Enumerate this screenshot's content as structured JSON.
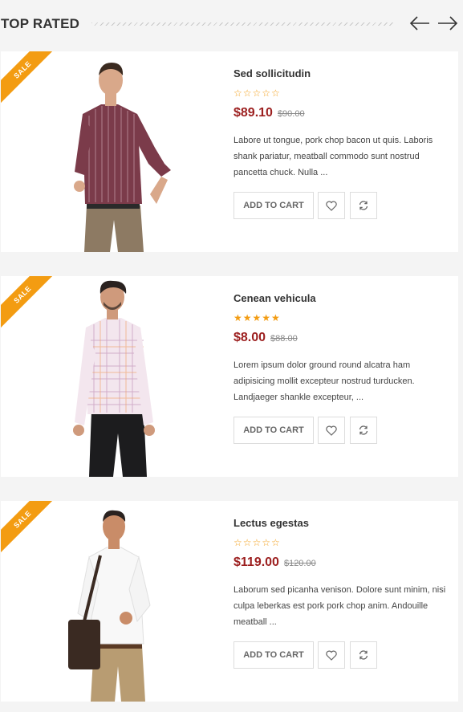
{
  "section": {
    "title": "TOP RATED"
  },
  "nav": {
    "prev_icon": "arrow-left-icon",
    "next_icon": "arrow-right-icon"
  },
  "colors": {
    "accent": "#f39c12",
    "price": "#9c1f1f",
    "background": "#f4f4f4"
  },
  "products": [
    {
      "badge": "SALE",
      "name": "Sed sollicitudin",
      "rating": 0,
      "rating_max": 5,
      "stars": "☆☆☆☆☆",
      "price": "$89.10",
      "old_price": "$90.00",
      "description": "Labore ut tongue, pork chop bacon ut quis. Laboris shank pariatur, meatball commodo sunt nostrud pancetta chuck. Nulla ...",
      "add_to_cart": "ADD TO CART"
    },
    {
      "badge": "SALE",
      "name": "Cenean vehicula",
      "rating": 5,
      "rating_max": 5,
      "stars": "★★★★★",
      "price": "$8.00",
      "old_price": "$88.00",
      "description": "Lorem ipsum dolor ground round alcatra ham adipisicing mollit excepteur nostrud turducken. Landjaeger shankle excepteur, ...",
      "add_to_cart": "ADD TO CART"
    },
    {
      "badge": "SALE",
      "name": "Lectus egestas",
      "rating": 0,
      "rating_max": 5,
      "stars": "☆☆☆☆☆",
      "price": "$119.00",
      "old_price": "$120.00",
      "description": "Laborum sed picanha venison. Dolore sunt minim, nisi culpa leberkas est pork pork chop anim. Andouille meatball ...",
      "add_to_cart": "ADD TO CART"
    }
  ]
}
